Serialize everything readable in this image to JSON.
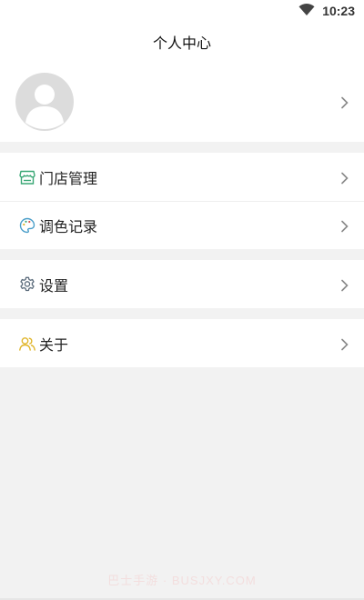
{
  "status_bar": {
    "time": "10:23",
    "wifi_icon": "wifi-icon"
  },
  "header": {
    "title": "个人中心"
  },
  "profile": {
    "avatar_icon": "user-avatar-icon",
    "chevron_icon": "chevron-right-icon"
  },
  "menu": {
    "store": {
      "label": "门店管理",
      "icon": "store-icon",
      "color": "#3aa776"
    },
    "color_records": {
      "label": "调色记录",
      "icon": "palette-icon",
      "color": "#4a9ec9"
    },
    "settings": {
      "label": "设置",
      "icon": "gear-icon",
      "color": "#5b6b7b"
    },
    "about": {
      "label": "关于",
      "icon": "users-icon",
      "color": "#e0b52a"
    }
  },
  "watermark": "巴士手游 · BUSJXY.COM"
}
